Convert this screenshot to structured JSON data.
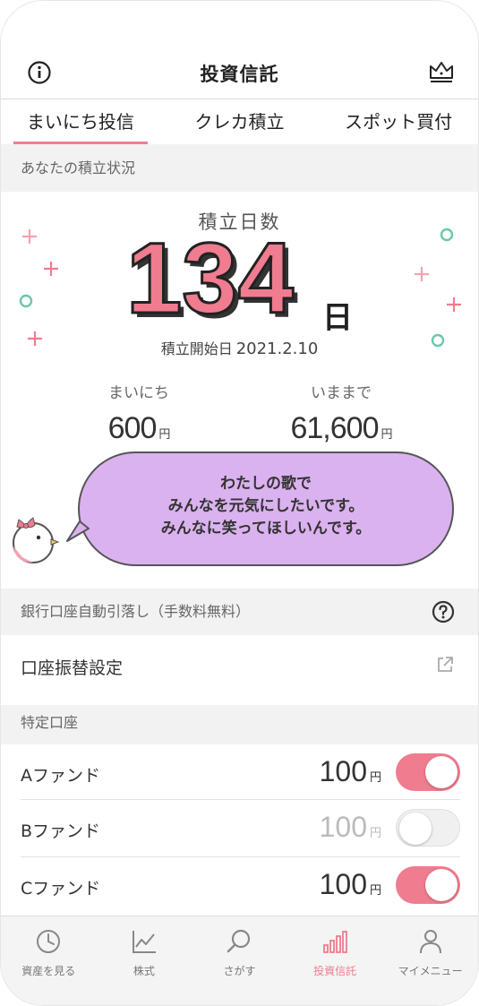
{
  "header": {
    "title": "投資信託",
    "info_icon": "info-icon",
    "crown_icon": "crown-icon"
  },
  "tabs": [
    {
      "label": "まいにち投信",
      "active": true
    },
    {
      "label": "クレカ積立",
      "active": false
    },
    {
      "label": "スポット買付",
      "active": false
    }
  ],
  "accumulation": {
    "section_label": "あなたの積立状況",
    "title": "積立日数",
    "days": "134",
    "days_unit": "日",
    "start_label": "積立開始日",
    "start_date": "2021.2.10",
    "daily_label": "まいにち",
    "daily_value": "600",
    "total_label": "いままで",
    "total_value": "61,600",
    "currency_unit": "円",
    "message_line1": "わたしの歌で",
    "message_line2": "みんなを元気にしたいです。",
    "message_line3": "みんなに笑ってほしいんです。",
    "accent_color": "#f07c8f",
    "bubble_color": "#dbb2f0"
  },
  "bank": {
    "section_label": "銀行口座自動引落し（手数料無料）",
    "help_icon": "question-icon",
    "transfer_setting_label": "口座振替設定",
    "external_link_icon": "external-link-icon"
  },
  "specific_account": {
    "section_label": "特定口座",
    "funds": [
      {
        "name": "Aファンド",
        "amount": "100",
        "unit": "円",
        "enabled": true
      },
      {
        "name": "Bファンド",
        "amount": "100",
        "unit": "円",
        "enabled": false
      },
      {
        "name": "Cファンド",
        "amount": "100",
        "unit": "円",
        "enabled": true
      }
    ]
  },
  "bottom_nav": [
    {
      "label": "資産を見る",
      "icon": "pie-clock-icon",
      "active": false
    },
    {
      "label": "株式",
      "icon": "line-chart-icon",
      "active": false
    },
    {
      "label": "さがす",
      "icon": "search-icon",
      "active": false
    },
    {
      "label": "投資信託",
      "icon": "bar-chart-icon",
      "active": true
    },
    {
      "label": "マイメニュー",
      "icon": "person-icon",
      "active": false
    }
  ]
}
